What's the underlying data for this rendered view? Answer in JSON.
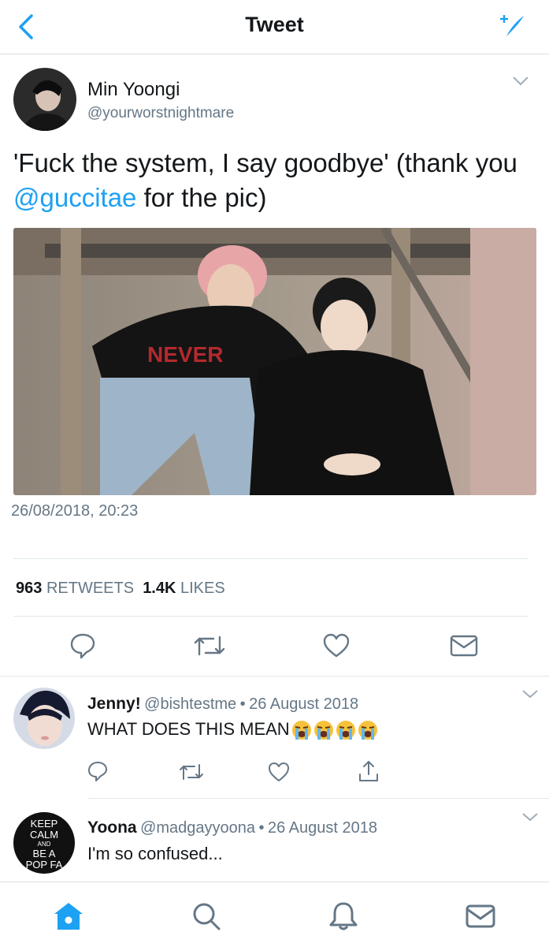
{
  "header": {
    "title": "Tweet",
    "back_icon": "chevron-left-icon",
    "compose_icon": "compose-tweet-icon"
  },
  "tweet": {
    "name": "Min Yoongi",
    "handle": "@yourworstnightmare",
    "text_before": "'Fuck the system, I say goodbye' (thank you ",
    "mention": "@guccitae",
    "text_after": " for the pic)",
    "timestamp": "26/08/2018, 20:23",
    "retweets_count": "963",
    "retweets_label": "RETWEETS",
    "likes_count": "1.4K",
    "likes_label": "LIKES"
  },
  "replies": [
    {
      "name": "Jenny!",
      "handle": "@bishtestme",
      "date": "26 August 2018",
      "text": "WHAT DOES THIS MEAN",
      "emoji": "loudly-crying-face"
    },
    {
      "name": "Yoona",
      "handle": "@madgayyoona",
      "date": "26 August 2018",
      "text": "I'm so confused...",
      "avatar_lines": [
        "KEEP",
        "CALM",
        "AND",
        "BE A",
        "POP FA"
      ]
    }
  ],
  "bottom_nav": [
    "home-icon",
    "search-icon",
    "notifications-icon",
    "messages-icon"
  ],
  "colors": {
    "accent": "#1da1f2",
    "muted": "#657786",
    "text": "#14171a",
    "divider": "#e1e8ed"
  }
}
